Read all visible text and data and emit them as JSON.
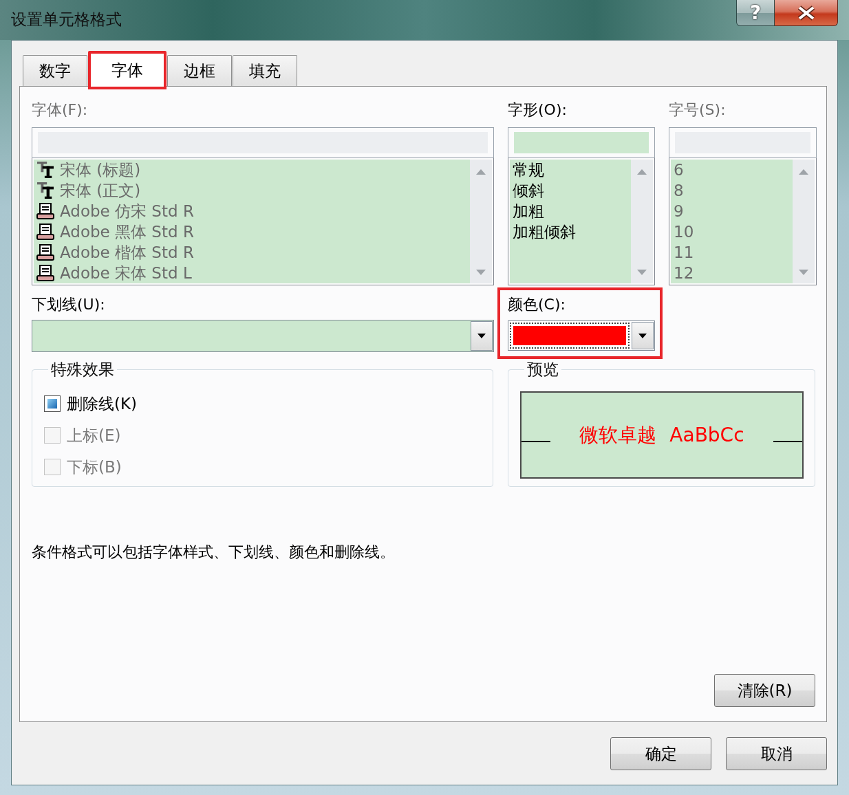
{
  "window": {
    "title": "设置单元格格式",
    "help_button": "?"
  },
  "tabs": [
    {
      "label": "数字",
      "selected": false,
      "highlighted": false
    },
    {
      "label": "字体",
      "selected": true,
      "highlighted": true
    },
    {
      "label": "边框",
      "selected": false,
      "highlighted": false
    },
    {
      "label": "填充",
      "selected": false,
      "highlighted": false
    }
  ],
  "lists": [
    {
      "label": "字体(F):",
      "disabled": true,
      "items": [
        {
          "text": "宋体 (标题)",
          "kind": "truetype"
        },
        {
          "text": "宋体 (正文)",
          "kind": "truetype"
        },
        {
          "text": "Adobe 仿宋 Std R",
          "kind": "printer"
        },
        {
          "text": "Adobe 黑体 Std R",
          "kind": "printer"
        },
        {
          "text": "Adobe 楷体 Std R",
          "kind": "printer"
        },
        {
          "text": "Adobe 宋体 Std L",
          "kind": "printer"
        }
      ]
    },
    {
      "label": "字形(O):",
      "disabled": false,
      "items": [
        {
          "text": "常规"
        },
        {
          "text": "倾斜"
        },
        {
          "text": "加粗"
        },
        {
          "text": "加粗倾斜"
        }
      ]
    },
    {
      "label": "字号(S):",
      "disabled": true,
      "items": [
        {
          "text": "6"
        },
        {
          "text": "8"
        },
        {
          "text": "9"
        },
        {
          "text": "10"
        },
        {
          "text": "11"
        },
        {
          "text": "12"
        }
      ]
    }
  ],
  "underline": {
    "label": "下划线(U):",
    "disabled": false
  },
  "color_field": {
    "label": "颜色(C):",
    "color": "#ff0000",
    "focused": true,
    "highlighted": true
  },
  "effects": {
    "title": "特殊效果",
    "options": [
      {
        "label": "删除线(K)",
        "checked": true,
        "disabled": false
      },
      {
        "label": "上标(E)",
        "checked": false,
        "disabled": true
      },
      {
        "label": "下标(B)",
        "checked": false,
        "disabled": true
      }
    ]
  },
  "preview": {
    "title": "预览",
    "sample": "微软卓越 AaBbCc"
  },
  "note": "条件格式可以包括字体样式、下划线、颜色和删除线。",
  "clear_button": "清除(R)",
  "buttons": [
    "确定",
    "取消"
  ]
}
